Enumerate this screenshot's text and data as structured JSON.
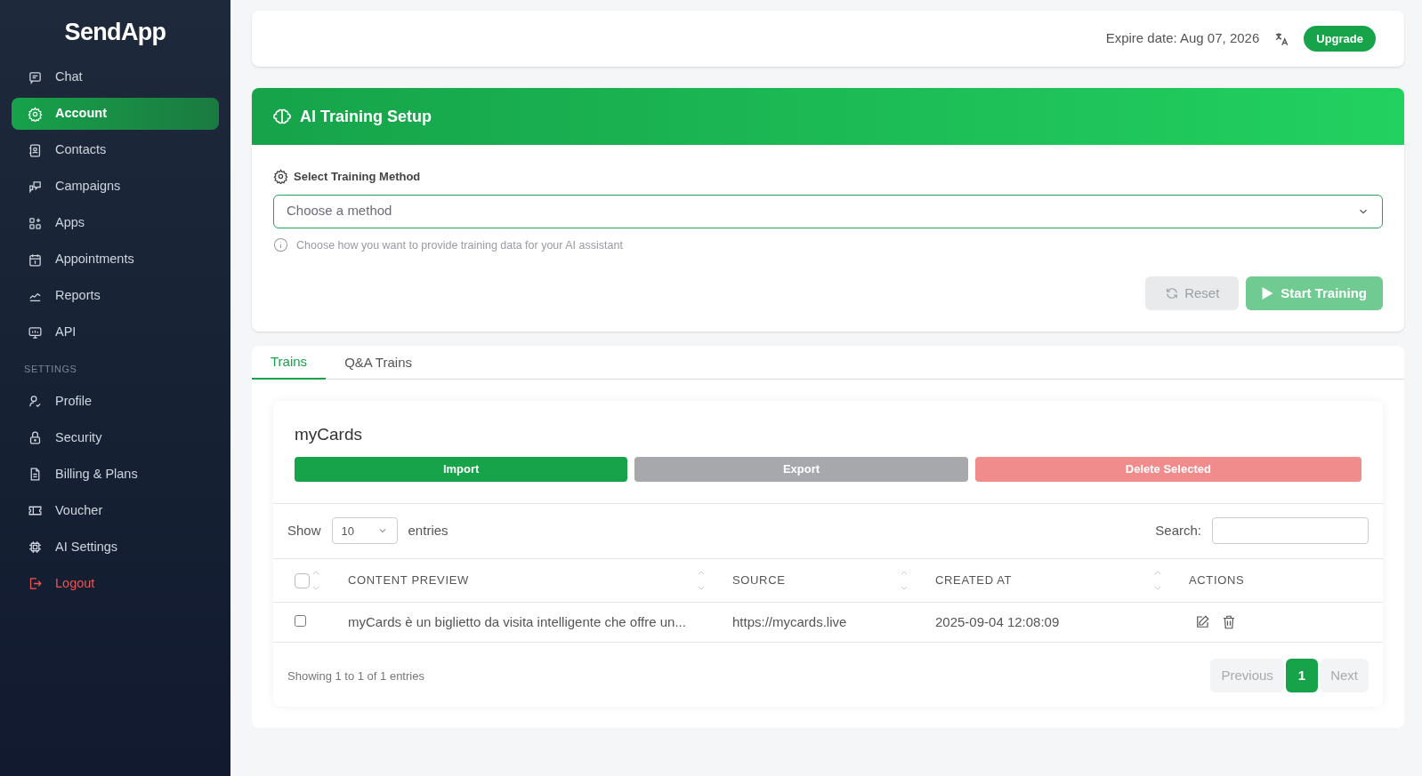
{
  "sidebar": {
    "logo": "SendApp",
    "items": [
      {
        "kind": "link",
        "label": "Chat",
        "selected": false
      },
      {
        "kind": "link",
        "label": "Account",
        "selected": true
      },
      {
        "kind": "link",
        "label": "Contacts",
        "selected": false
      },
      {
        "kind": "link",
        "label": "Campaigns",
        "selected": false
      },
      {
        "kind": "link",
        "label": "Apps",
        "selected": false
      },
      {
        "kind": "link",
        "label": "Appointments",
        "selected": false
      },
      {
        "kind": "link",
        "label": "Reports",
        "selected": false
      },
      {
        "kind": "link",
        "label": "API",
        "selected": false
      },
      {
        "kind": "heading",
        "label": "SETTINGS"
      },
      {
        "kind": "link",
        "label": "Profile",
        "selected": false
      },
      {
        "kind": "link",
        "label": "Security",
        "selected": false
      },
      {
        "kind": "link",
        "label": "Billing & Plans",
        "selected": false
      },
      {
        "kind": "link",
        "label": "Voucher",
        "selected": false
      },
      {
        "kind": "link",
        "label": "AI Settings",
        "selected": false
      },
      {
        "kind": "logout",
        "label": "Logout",
        "selected": false
      }
    ]
  },
  "topbar": {
    "expire": "Expire date: Aug 07, 2026",
    "upgrade": "Upgrade"
  },
  "training": {
    "title": "AI Training Setup",
    "method_label": "Select Training Method",
    "placeholder": "Choose a method",
    "hint": "Choose how you want to provide training data for your AI assistant",
    "buttons": [
      {
        "kind": "reset",
        "label": "Reset",
        "disabled": true
      },
      {
        "kind": "start",
        "label": "Start Training",
        "disabled": true
      }
    ]
  },
  "tabs": [
    {
      "label": "Trains",
      "selected": true
    },
    {
      "label": "Q&A Trains",
      "selected": false
    }
  ],
  "panel": {
    "title": "myCards",
    "actions": [
      {
        "kind": "import",
        "label": "Import"
      },
      {
        "kind": "export",
        "label": "Export"
      },
      {
        "kind": "delete",
        "label": "Delete Selected"
      }
    ],
    "show": "Show",
    "page_size": "10",
    "entries": "entries",
    "search_label": "Search:",
    "table": {
      "select_all_checked": false,
      "columns": [
        "CONTENT PREVIEW",
        "SOURCE",
        "CREATED AT",
        "ACTIONS"
      ],
      "rows": [
        {
          "checked": false,
          "content": "myCards è un biglietto da visita intelligente che offre un...",
          "source": "https://mycards.live",
          "created": "2025-09-04 12:08:09"
        }
      ]
    },
    "info": "Showing 1 to 1 of 1 entries",
    "pagination": [
      {
        "label": "Previous",
        "kind": "prev",
        "selected": false
      },
      {
        "label": "1",
        "kind": "page",
        "selected": true
      },
      {
        "label": "Next",
        "kind": "next",
        "selected": false
      }
    ]
  }
}
